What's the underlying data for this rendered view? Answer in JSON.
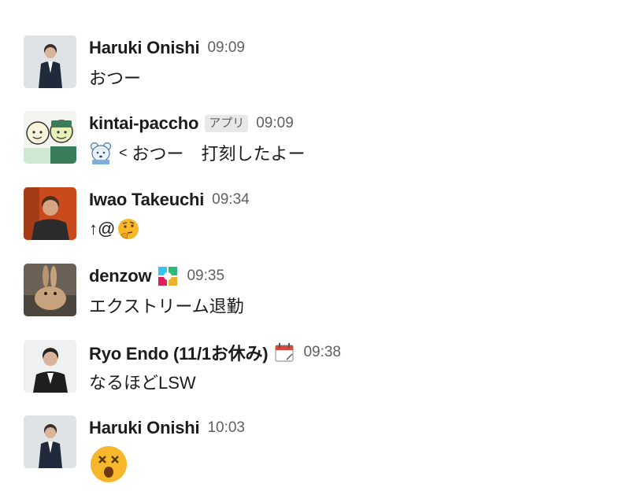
{
  "messages": [
    {
      "name": "Haruki Onishi",
      "time": "09:09",
      "text": "おつー",
      "avatar": "person-avatar"
    },
    {
      "name": "kintai-paccho",
      "badge": "アプリ",
      "time": "09:09",
      "text_prefix": "<",
      "text": "おつー　打刻したよー",
      "avatar": "bot-avatar",
      "inline_emoji": "bear-face-icon"
    },
    {
      "name": "Iwao Takeuchi",
      "time": "09:34",
      "text": "↑@",
      "avatar": "person-avatar",
      "inline_emoji": "thinking-face-emoji"
    },
    {
      "name": "denzow",
      "time": "09:35",
      "text": "エクストリーム退勤",
      "avatar": "rabbit-avatar",
      "status_icon": "slack-logo-icon"
    },
    {
      "name": "Ryo Endo (11/1お休み)",
      "time": "09:38",
      "text": "なるほどLSW",
      "avatar": "person-avatar",
      "status_icon": "calendar-icon"
    },
    {
      "name": "Haruki Onishi",
      "time": "10:03",
      "avatar": "person-avatar",
      "inline_emoji": "dizzy-face-emoji"
    }
  ],
  "colors": {
    "name": "#1d1c1d",
    "timestamp": "#616061",
    "badge_bg": "#e8e8e8",
    "emoji_yellow": "#f7b72a"
  }
}
